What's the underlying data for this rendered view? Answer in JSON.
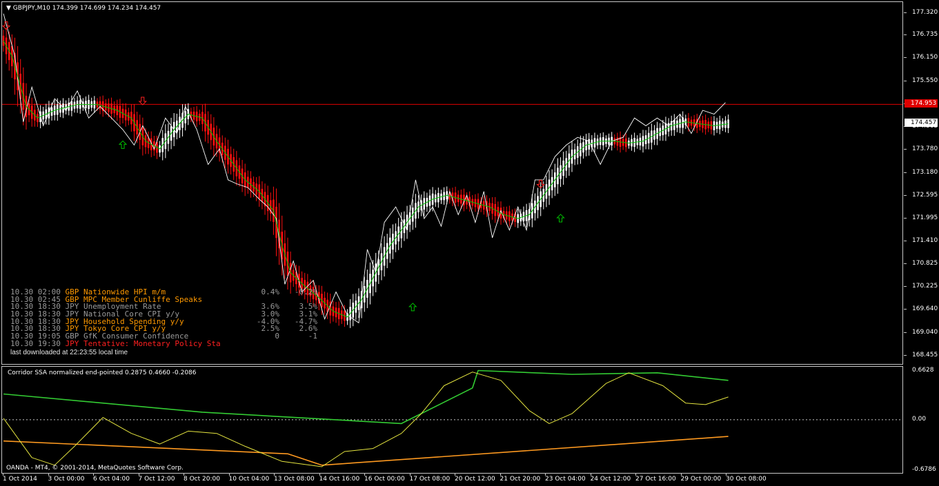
{
  "chart_header": "GBPJPY,M10  174.399 174.699 174.234 174.457",
  "indicator_header": "Corridor SSA normalized end-pointed 0.2875 0.4660 -0.2086",
  "copyright": "OANDA - MT4, © 2001-2014, MetaQuotes Software Corp.",
  "colors": {
    "background": "#000000",
    "frame": "#c8c8c8",
    "line_level": "#e00000",
    "bull": "#ffffff",
    "bear": "#ff1010",
    "ssa": "#00c000",
    "price_overlay": "#ffffff",
    "up_arrow": "#00c000",
    "down_arrow": "#ff2020",
    "ind_green": "#33cc33",
    "ind_yellow": "#e6e640",
    "ind_orange": "#ff9a20",
    "news_time": "#9a9a9a"
  },
  "price_axis": [
    "177.320",
    "176.735",
    "176.150",
    "175.550",
    "174.965",
    "174.365",
    "173.780",
    "173.180",
    "172.595",
    "171.995",
    "171.410",
    "170.825",
    "170.225",
    "169.640",
    "169.040",
    "168.455"
  ],
  "level_tag": "174.953",
  "bid_tag": "174.457",
  "indicator_axis": [
    "0.6628",
    "0.00",
    "-0.6786"
  ],
  "time_axis": [
    "1 Oct 2014",
    "3 Oct 00:00",
    "6 Oct 04:00",
    "7 Oct 12:00",
    "8 Oct 20:00",
    "10 Oct 04:00",
    "13 Oct 08:00",
    "14 Oct 16:00",
    "16 Oct 00:00",
    "17 Oct 08:00",
    "20 Oct 12:00",
    "21 Oct 20:00",
    "23 Oct 04:00",
    "24 Oct 12:00",
    "27 Oct 16:00",
    "29 Oct 00:00",
    "30 Oct 08:00"
  ],
  "news": {
    "rows": [
      {
        "time": "10.30 02:00",
        "text": "GBP Nationwide HPI m/m",
        "color": "#ff9900",
        "v1": "0.4%",
        "v2": "-0.2%"
      },
      {
        "time": "10.30 02:45",
        "text": "GBP MPC Member Cunliffe Speaks",
        "color": "#ff9900",
        "v1": "",
        "v2": ""
      },
      {
        "time": "10.30 18:30",
        "text": "JPY Unemployment Rate",
        "color": "#9a9a9a",
        "v1": "3.6%",
        "v2": "3.5%"
      },
      {
        "time": "10.30 18:30",
        "text": "JPY National Core CPI y/y",
        "color": "#9a9a9a",
        "v1": "3.0%",
        "v2": "3.1%"
      },
      {
        "time": "10.30 18:30",
        "text": "JPY Household Spending y/y",
        "color": "#ff9900",
        "v1": "-4.0%",
        "v2": "-4.7%"
      },
      {
        "time": "10.30 18:30",
        "text": "JPY Tokyo Core CPI y/y",
        "color": "#ff9900",
        "v1": "2.5%",
        "v2": "2.6%"
      },
      {
        "time": "10.30 19:05",
        "text": "GBP GfK Consumer Confidence",
        "color": "#9a9a9a",
        "v1": "0",
        "v2": "-1"
      },
      {
        "time": "10.30 19:30",
        "text": "JPY Tentative: Monetary Policy Sta",
        "color": "#ff2020",
        "v1": "",
        "v2": ""
      }
    ],
    "footer": "last downloaded at 22:23:55 local time"
  },
  "chart_data": {
    "type": "candlestick",
    "symbol": "GBPJPY",
    "timeframe": "M10",
    "ylim": [
      168.2,
      177.6
    ],
    "horizontal_level": 174.953,
    "last_bid": 174.457,
    "ssa_path": [
      [
        0,
        176.6
      ],
      [
        3,
        176.2
      ],
      [
        8,
        174.9
      ],
      [
        12,
        174.6
      ],
      [
        18,
        174.8
      ],
      [
        26,
        174.95
      ],
      [
        33,
        174.95
      ],
      [
        40,
        174.8
      ],
      [
        45,
        174.6
      ],
      [
        50,
        174.0
      ],
      [
        55,
        173.8
      ],
      [
        60,
        174.3
      ],
      [
        65,
        174.7
      ],
      [
        70,
        174.6
      ],
      [
        75,
        174.0
      ],
      [
        80,
        173.5
      ],
      [
        85,
        173.0
      ],
      [
        90,
        172.7
      ],
      [
        95,
        172.2
      ],
      [
        98,
        171.3
      ],
      [
        101,
        170.6
      ],
      [
        106,
        170.25
      ],
      [
        111,
        169.95
      ],
      [
        116,
        169.6
      ],
      [
        121,
        169.45
      ],
      [
        126,
        169.9
      ],
      [
        131,
        170.6
      ],
      [
        136,
        171.3
      ],
      [
        141,
        171.8
      ],
      [
        146,
        172.3
      ],
      [
        151,
        172.5
      ],
      [
        156,
        172.6
      ],
      [
        161,
        172.5
      ],
      [
        166,
        172.4
      ],
      [
        171,
        172.3
      ],
      [
        176,
        172.1
      ],
      [
        181,
        172.0
      ],
      [
        185,
        172.1
      ],
      [
        190,
        172.6
      ],
      [
        195,
        173.1
      ],
      [
        200,
        173.6
      ],
      [
        205,
        173.9
      ],
      [
        210,
        174.0
      ],
      [
        215,
        174.0
      ],
      [
        220,
        173.95
      ],
      [
        225,
        174.0
      ],
      [
        230,
        174.2
      ],
      [
        235,
        174.4
      ],
      [
        240,
        174.5
      ],
      [
        245,
        174.45
      ],
      [
        250,
        174.4
      ],
      [
        255,
        174.45
      ]
    ],
    "price_overlay_path": [
      [
        0,
        177.3
      ],
      [
        4,
        176.2
      ],
      [
        7,
        174.5
      ],
      [
        10,
        175.4
      ],
      [
        14,
        174.4
      ],
      [
        18,
        175.1
      ],
      [
        22,
        174.8
      ],
      [
        26,
        175.3
      ],
      [
        30,
        174.6
      ],
      [
        34,
        174.9
      ],
      [
        38,
        174.6
      ],
      [
        42,
        174.3
      ],
      [
        46,
        173.9
      ],
      [
        49,
        174.4
      ],
      [
        53,
        173.8
      ],
      [
        57,
        174.6
      ],
      [
        61,
        174.2
      ],
      [
        64,
        174.9
      ],
      [
        68,
        174.3
      ],
      [
        72,
        173.4
      ],
      [
        76,
        173.8
      ],
      [
        79,
        173.0
      ],
      [
        82,
        172.9
      ],
      [
        86,
        172.8
      ],
      [
        90,
        172.5
      ],
      [
        93,
        172.3
      ],
      [
        96,
        172.0
      ],
      [
        99,
        170.3
      ],
      [
        102,
        170.9
      ],
      [
        105,
        170.1
      ],
      [
        109,
        170.4
      ],
      [
        113,
        169.4
      ],
      [
        117,
        170.1
      ],
      [
        121,
        169.5
      ],
      [
        125,
        169.3
      ],
      [
        128,
        171.2
      ],
      [
        131,
        170.6
      ],
      [
        134,
        171.9
      ],
      [
        138,
        172.3
      ],
      [
        142,
        171.7
      ],
      [
        145,
        173.0
      ],
      [
        148,
        172.0
      ],
      [
        151,
        172.3
      ],
      [
        154,
        171.8
      ],
      [
        157,
        172.7
      ],
      [
        160,
        172.1
      ],
      [
        163,
        172.6
      ],
      [
        166,
        171.9
      ],
      [
        169,
        172.7
      ],
      [
        172,
        171.5
      ],
      [
        175,
        172.2
      ],
      [
        178,
        171.7
      ],
      [
        181,
        172.3
      ],
      [
        184,
        171.7
      ],
      [
        187,
        173.0
      ],
      [
        190,
        173.0
      ],
      [
        194,
        173.6
      ],
      [
        198,
        173.9
      ],
      [
        202,
        174.1
      ],
      [
        206,
        174.0
      ],
      [
        210,
        173.4
      ],
      [
        214,
        174.0
      ],
      [
        218,
        174.1
      ],
      [
        222,
        174.6
      ],
      [
        226,
        174.4
      ],
      [
        230,
        174.6
      ],
      [
        234,
        174.4
      ],
      [
        238,
        174.7
      ],
      [
        242,
        174.2
      ],
      [
        246,
        174.8
      ],
      [
        250,
        174.7
      ],
      [
        254,
        175.0
      ]
    ],
    "up_arrows": [
      [
        42,
        173.9
      ],
      [
        144,
        169.7
      ],
      [
        196,
        172.0
      ]
    ],
    "down_arrows": [
      [
        0,
        177.0
      ],
      [
        48,
        175.05
      ],
      [
        188,
        172.9
      ]
    ],
    "indicator": {
      "ylim": [
        -0.72,
        0.7
      ],
      "zero_line": 0.0,
      "green_path": [
        [
          0,
          0.34
        ],
        [
          70,
          0.1
        ],
        [
          140,
          -0.05
        ],
        [
          165,
          0.42
        ],
        [
          167,
          0.65
        ],
        [
          200,
          0.6
        ],
        [
          230,
          0.62
        ],
        [
          255,
          0.52
        ]
      ],
      "orange_path": [
        [
          0,
          -0.28
        ],
        [
          100,
          -0.45
        ],
        [
          112,
          -0.6
        ],
        [
          255,
          -0.22
        ]
      ],
      "yellow_path": [
        [
          0,
          0.02
        ],
        [
          10,
          -0.5
        ],
        [
          18,
          -0.6
        ],
        [
          25,
          -0.35
        ],
        [
          35,
          0.03
        ],
        [
          45,
          -0.18
        ],
        [
          55,
          -0.32
        ],
        [
          65,
          -0.15
        ],
        [
          75,
          -0.18
        ],
        [
          85,
          -0.35
        ],
        [
          98,
          -0.55
        ],
        [
          112,
          -0.62
        ],
        [
          120,
          -0.42
        ],
        [
          130,
          -0.38
        ],
        [
          140,
          -0.18
        ],
        [
          147,
          0.08
        ],
        [
          155,
          0.45
        ],
        [
          165,
          0.63
        ],
        [
          175,
          0.52
        ],
        [
          185,
          0.12
        ],
        [
          192,
          -0.05
        ],
        [
          200,
          0.08
        ],
        [
          212,
          0.48
        ],
        [
          220,
          0.62
        ],
        [
          232,
          0.45
        ],
        [
          240,
          0.22
        ],
        [
          247,
          0.2
        ],
        [
          255,
          0.3
        ]
      ]
    }
  }
}
